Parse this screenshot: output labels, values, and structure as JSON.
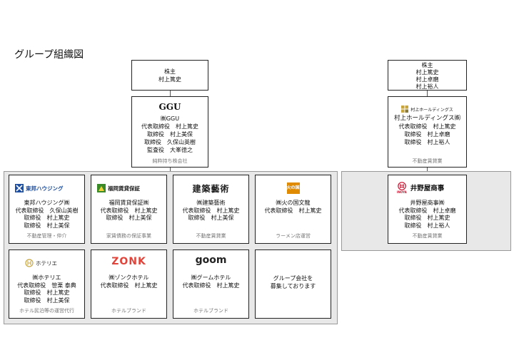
{
  "title": "グループ組織図",
  "left": {
    "shareholder": {
      "label": "株主",
      "names": [
        "村上篤史"
      ]
    },
    "holding": {
      "logo": "GGU",
      "company": "㈱GGU",
      "officers": [
        "代表取締役　村上篤史",
        "取締役　村上美保",
        "取締役　久保山英樹",
        "監査役　大峯徳之"
      ],
      "category": "純粋持ち株会社"
    },
    "subsidiaries": [
      {
        "logo": "東邦ハウジング",
        "company": "東邦ハウジング㈱",
        "officers": [
          "代表取締役　久保山英樹",
          "取締役　村上篤史",
          "取締役　村上美保"
        ],
        "category": "不動産管理・仲介",
        "color": "#1f4fa0"
      },
      {
        "logo": "福岡賃貸保証",
        "company": "福岡賃貸保証㈱",
        "officers": [
          "代表取締役　村上篤史",
          "取締役　村上美保"
        ],
        "category": "家賃債務の保証事業",
        "color": "#3a8a2a"
      },
      {
        "logo": "建築藝術",
        "company": "㈱建築藝術",
        "officers": [
          "代表取締役　村上篤史",
          "取締役　村上美保"
        ],
        "category": "不動産賃貸業"
      },
      {
        "logo": "火の国",
        "company": "㈱火の国文龍",
        "officers": [
          "代表取締役　村上篤史"
        ],
        "category": "ラーメン店運営",
        "color": "#e08a00"
      },
      {
        "logo": "ホテリエ",
        "company": "㈱ホテリエ",
        "officers": [
          "代表取締役　笹栗 泰典",
          "取締役　村上篤史",
          "取締役　村上美保"
        ],
        "category": "ホテル民泊等の運営代行",
        "color": "#c7a640"
      },
      {
        "logo": "ZONK",
        "company": "㈱ゾンクホテル",
        "officers": [
          "代表取締役　村上篤史"
        ],
        "category": "ホテルブランド",
        "color": "#e0443a"
      },
      {
        "logo": "goom",
        "company": "㈱グームホテル",
        "officers": [
          "代表取締役　村上篤史"
        ],
        "category": "ホテルブランド"
      },
      {
        "logo": "",
        "company": "",
        "officers": [
          "グループ会社を",
          "募集しております"
        ],
        "category": ""
      }
    ]
  },
  "right": {
    "shareholder": {
      "label": "株主",
      "names": [
        "村上篤史",
        "村上卓磨",
        "村上裕人"
      ]
    },
    "holding": {
      "logo": "村上ホールディングス",
      "company": "村上ホールディングス㈱",
      "officers": [
        "代表取締役　村上篤史",
        "取締役　村上卓磨",
        "取締役　村上裕人"
      ],
      "category": "不動産賃貸業"
    },
    "subsidiary": {
      "logo": "井野屋商事",
      "logo_sub": "INOYA",
      "company": "井野屋商事㈱",
      "officers": [
        "代表取締役　村上卓磨",
        "取締役　村上篤史",
        "取締役　村上裕人"
      ],
      "category": "不動産賃貸業",
      "color": "#c8102e"
    }
  }
}
